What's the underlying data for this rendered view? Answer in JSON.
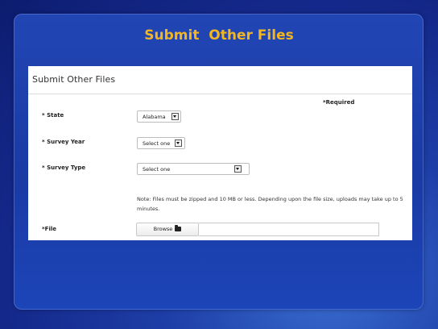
{
  "slide": {
    "title": "Submit  Other Files"
  },
  "form": {
    "heading": "Submit Other Files",
    "required_note": "*Required",
    "state": {
      "label": "* State",
      "value": "Alabama"
    },
    "survey_year": {
      "label": "* Survey Year",
      "value": "Select one"
    },
    "survey_type": {
      "label": "* Survey Type",
      "value": "Select one"
    },
    "note": "Note: Files must be zipped and 10 MB or less. Depending upon the file size, uploads may take up to 5 minutes.",
    "file": {
      "label": "*File",
      "browse_label": "Browse",
      "icon": "folder-icon",
      "path": ""
    }
  },
  "colors": {
    "title": "#f3b61f",
    "background": "#1a3aa4",
    "panel": "#ffffff"
  }
}
